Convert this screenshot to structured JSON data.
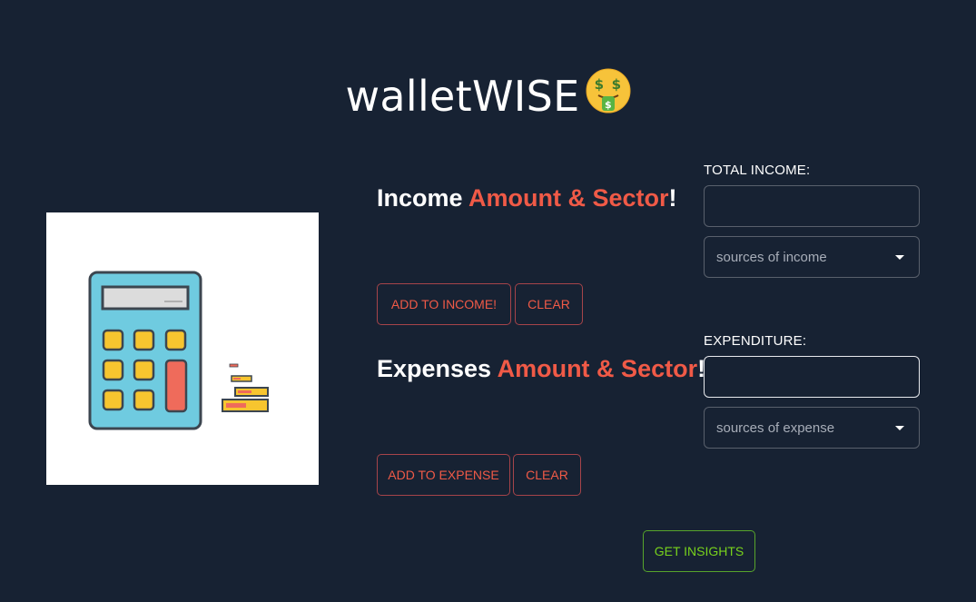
{
  "app": {
    "title": "walletWISE",
    "title_icon": "money-mouth-face-icon"
  },
  "income": {
    "heading_prefix": "Income ",
    "heading_accent": "Amount & Sector",
    "heading_suffix": "!",
    "field_label": "TOTAL INCOME:",
    "input_value": "",
    "select_placeholder": "sources of income",
    "add_label": "ADD TO INCOME!",
    "clear_label": "CLEAR"
  },
  "expense": {
    "heading_prefix": "Expenses ",
    "heading_accent": "Amount & Sector",
    "heading_suffix": "!",
    "field_label": "EXPENDITURE:",
    "input_value": "",
    "select_placeholder": "sources of expense",
    "add_label": "ADD TO EXPENSE",
    "clear_label": "CLEAR"
  },
  "insights": {
    "button_label": "GET INSIGHTS"
  },
  "illustration": {
    "icon": "calculator-coins-icon"
  },
  "colors": {
    "background": "#172233",
    "accent": "#f05a47",
    "insights": "#78d21c"
  }
}
